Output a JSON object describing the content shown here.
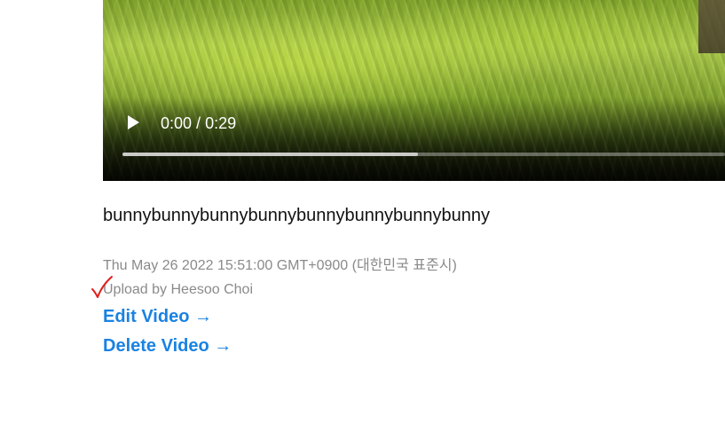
{
  "video": {
    "current_time": "0:00",
    "separator": " / ",
    "duration": "0:29",
    "buffered_fraction": 0.49,
    "play_icon": "play-icon"
  },
  "post": {
    "title": "bunnybunnybunnybunnybunnybunnybunnybunny",
    "date": "Thu May 26 2022 15:51:00 GMT+0900 (대한민국 표준시)",
    "uploader": "Upload by Heesoo Choi"
  },
  "actions": {
    "edit_label": "Edit Video →",
    "delete_label": "Delete Video →"
  },
  "annotation": {
    "mark_icon": "checkmark-icon",
    "mark_color": "#e0201c"
  },
  "colors": {
    "link": "#1a82e2",
    "muted_text": "#8a8a8a"
  }
}
